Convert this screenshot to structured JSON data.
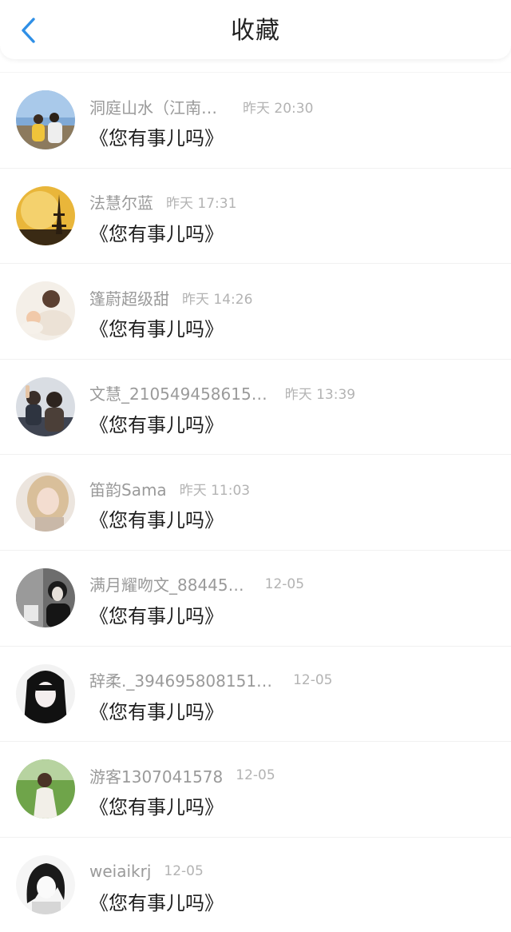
{
  "header": {
    "title": "收藏",
    "back_icon": "chevron-left-icon",
    "accent_color": "#2f8fe6"
  },
  "favorites": [
    {
      "name": "洞庭山水（江南…",
      "time": "昨天 20:30",
      "message": "《您有事儿吗》"
    },
    {
      "name": "法慧尔蓝",
      "time": "昨天 17:31",
      "message": "《您有事儿吗》"
    },
    {
      "name": "篷蔚超级甜",
      "time": "昨天 14:26",
      "message": "《您有事儿吗》"
    },
    {
      "name": "文慧_210549458615…",
      "time": "昨天 13:39",
      "message": "《您有事儿吗》"
    },
    {
      "name": "笛韵Sama",
      "time": "昨天 11:03",
      "message": "《您有事儿吗》"
    },
    {
      "name": "满月耀吻文_88445…",
      "time": "12-05",
      "message": "《您有事儿吗》"
    },
    {
      "name": "辞柔._394695808151…",
      "time": "12-05",
      "message": "《您有事儿吗》"
    },
    {
      "name": "游客1307041578",
      "time": "12-05",
      "message": "《您有事儿吗》"
    },
    {
      "name": "weiaikrj",
      "time": "12-05",
      "message": "《您有事儿吗》"
    }
  ]
}
